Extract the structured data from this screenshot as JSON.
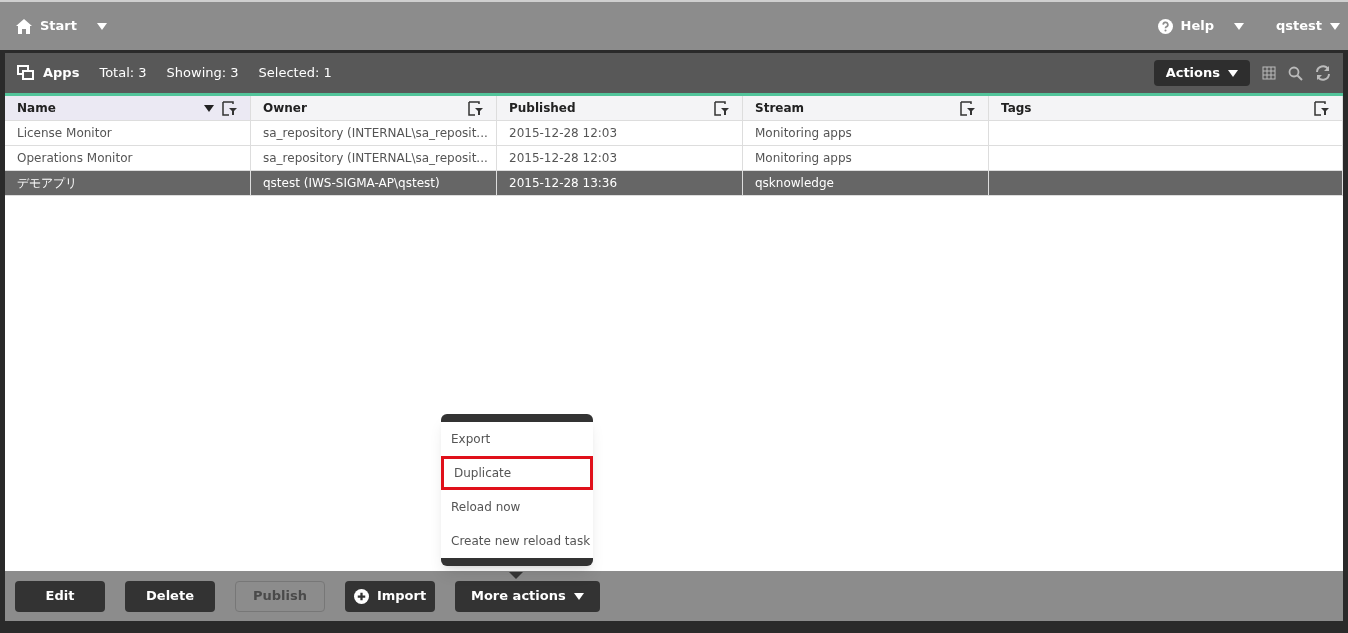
{
  "top_bar": {
    "start": "Start",
    "help": "Help",
    "user": "qstest"
  },
  "panel": {
    "title": "Apps",
    "total": "Total: 3",
    "showing": "Showing: 3",
    "selected": "Selected: 1",
    "actions": "Actions"
  },
  "table": {
    "columns": [
      {
        "label": "Name",
        "sorted": true
      },
      {
        "label": "Owner",
        "sorted": false
      },
      {
        "label": "Published",
        "sorted": false
      },
      {
        "label": "Stream",
        "sorted": false
      },
      {
        "label": "Tags",
        "sorted": false
      }
    ],
    "rows": [
      {
        "cells": [
          "License Monitor",
          "sa_repository (INTERNAL\\sa_reposit...",
          "2015-12-28 12:03",
          "Monitoring apps"
        ],
        "selected": false
      },
      {
        "cells": [
          "Operations Monitor",
          "sa_repository (INTERNAL\\sa_reposit...",
          "2015-12-28 12:03",
          "Monitoring apps"
        ],
        "selected": false
      },
      {
        "cells": [
          "デモアプリ",
          "qstest (IWS-SIGMA-AP\\qstest)",
          "2015-12-28 13:36",
          "qsknowledge"
        ],
        "selected": true
      }
    ]
  },
  "menu": {
    "items": [
      {
        "label": "Export",
        "highlighted": false
      },
      {
        "label": "Duplicate",
        "highlighted": true
      },
      {
        "label": "Reload now",
        "highlighted": false
      },
      {
        "label": "Create new reload task",
        "highlighted": false
      }
    ]
  },
  "footer_buttons": [
    {
      "label": "Edit",
      "kind": "plain",
      "disabled": false
    },
    {
      "label": "Delete",
      "kind": "plain",
      "disabled": false
    },
    {
      "label": "Publish",
      "kind": "plain",
      "disabled": true
    },
    {
      "label": "Import",
      "kind": "import",
      "disabled": false
    },
    {
      "label": "More actions",
      "kind": "dropdown",
      "disabled": false
    }
  ]
}
